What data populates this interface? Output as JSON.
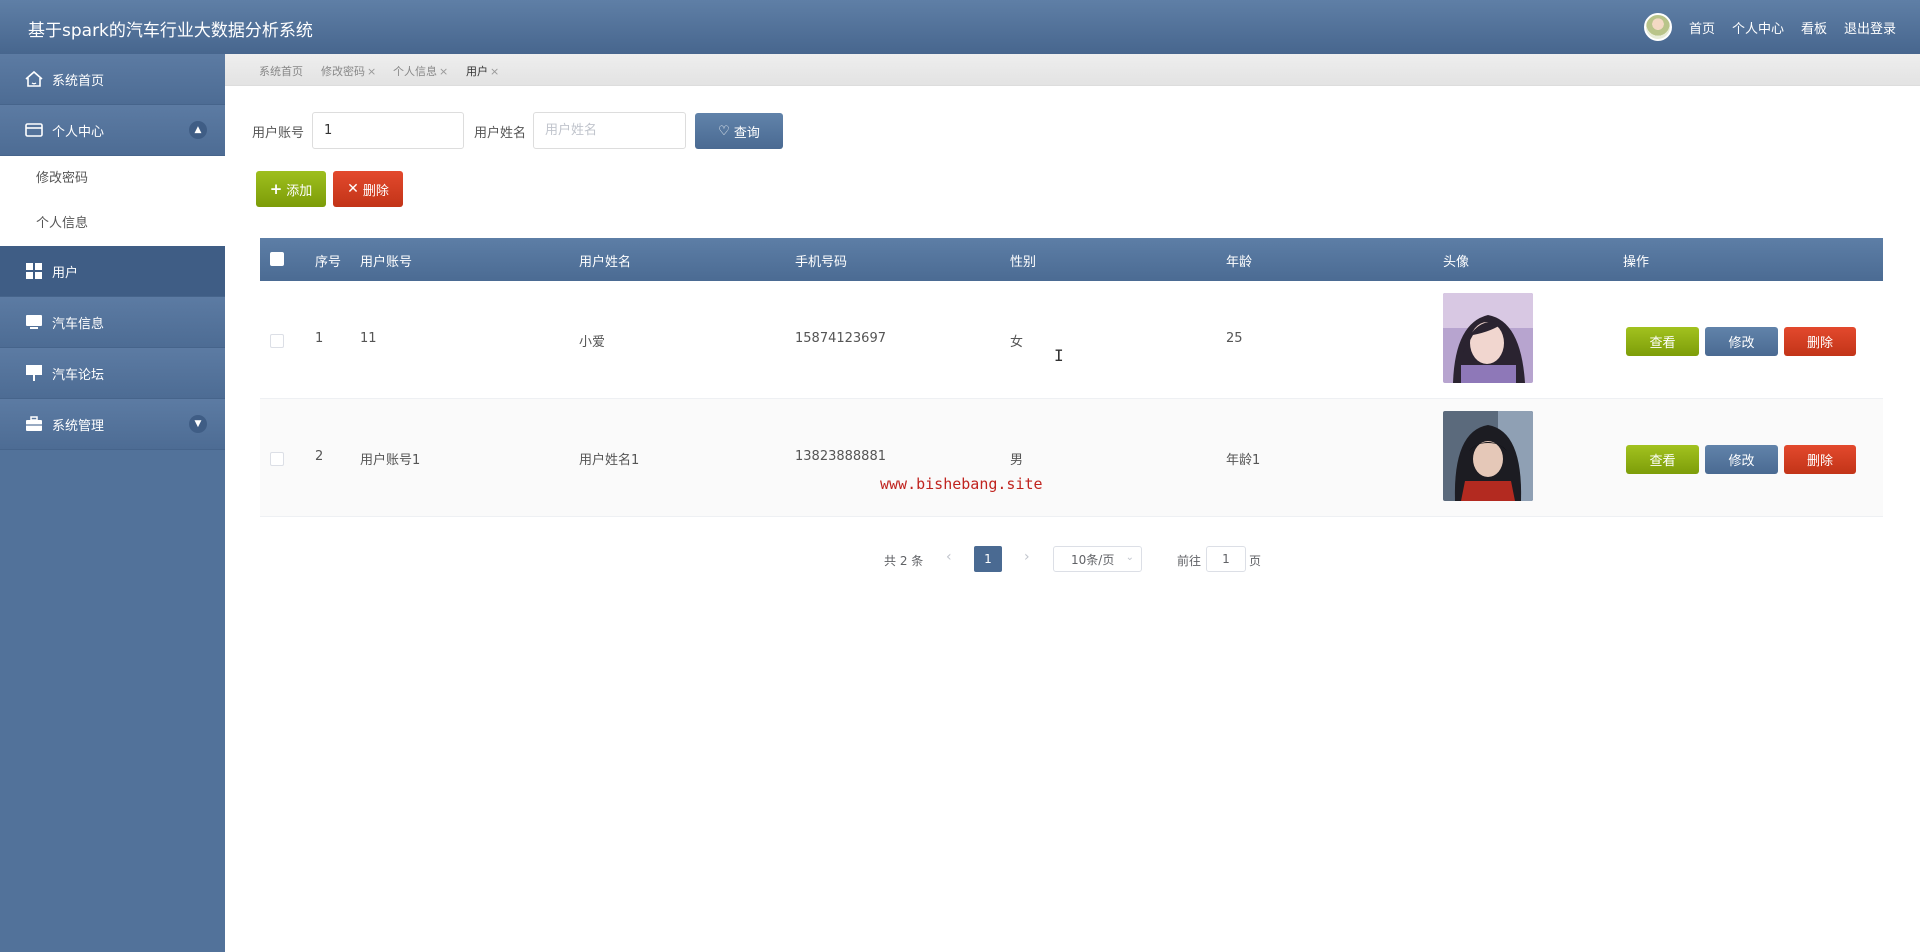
{
  "header": {
    "app_title": "基于spark的汽车行业大数据分析系统",
    "links": [
      "首页",
      "个人中心",
      "看板",
      "退出登录"
    ]
  },
  "sidebar": {
    "items": [
      {
        "label": "系统首页",
        "icon": "home-icon"
      },
      {
        "label": "个人中心",
        "icon": "card-icon",
        "expanded": true,
        "children": [
          "修改密码",
          "个人信息"
        ]
      },
      {
        "label": "用户",
        "icon": "grid-icon",
        "active": true
      },
      {
        "label": "汽车信息",
        "icon": "monitor-icon"
      },
      {
        "label": "汽车论坛",
        "icon": "board-icon"
      },
      {
        "label": "系统管理",
        "icon": "briefcase-icon",
        "expanded": false
      }
    ]
  },
  "tabs": [
    {
      "label": "系统首页",
      "closable": false
    },
    {
      "label": "修改密码",
      "closable": true
    },
    {
      "label": "个人信息",
      "closable": true
    },
    {
      "label": "用户",
      "closable": true,
      "active": true
    }
  ],
  "tab_close": "×",
  "search": {
    "account_label": "用户账号",
    "account_value": "1",
    "name_label": "用户姓名",
    "name_placeholder": "用户姓名",
    "query_label": "查询"
  },
  "actions": {
    "add_label": "添加",
    "delete_label": "删除"
  },
  "table": {
    "columns": [
      "序号",
      "用户账号",
      "用户姓名",
      "手机号码",
      "性别",
      "年龄",
      "头像",
      "操作"
    ],
    "rows": [
      {
        "index": "1",
        "account": "11",
        "name": "小爱",
        "phone": "15874123697",
        "gender": "女",
        "age": "25"
      },
      {
        "index": "2",
        "account": "用户账号1",
        "name": "用户姓名1",
        "phone": "13823888881",
        "gender": "男",
        "age": "年龄1"
      }
    ],
    "ops": {
      "view": "查看",
      "edit": "修改",
      "delete": "删除"
    }
  },
  "watermark": "www.bishebang.site",
  "pagination": {
    "total_text": "共 2 条",
    "prev": "‹",
    "current_page": "1",
    "next": "›",
    "page_size": "10条/页",
    "goto_label": "前往",
    "goto_value": "1",
    "page_suffix": "页"
  },
  "colors": {
    "primary": "#4a6a92",
    "success": "#8bad12",
    "danger": "#d13f22"
  }
}
